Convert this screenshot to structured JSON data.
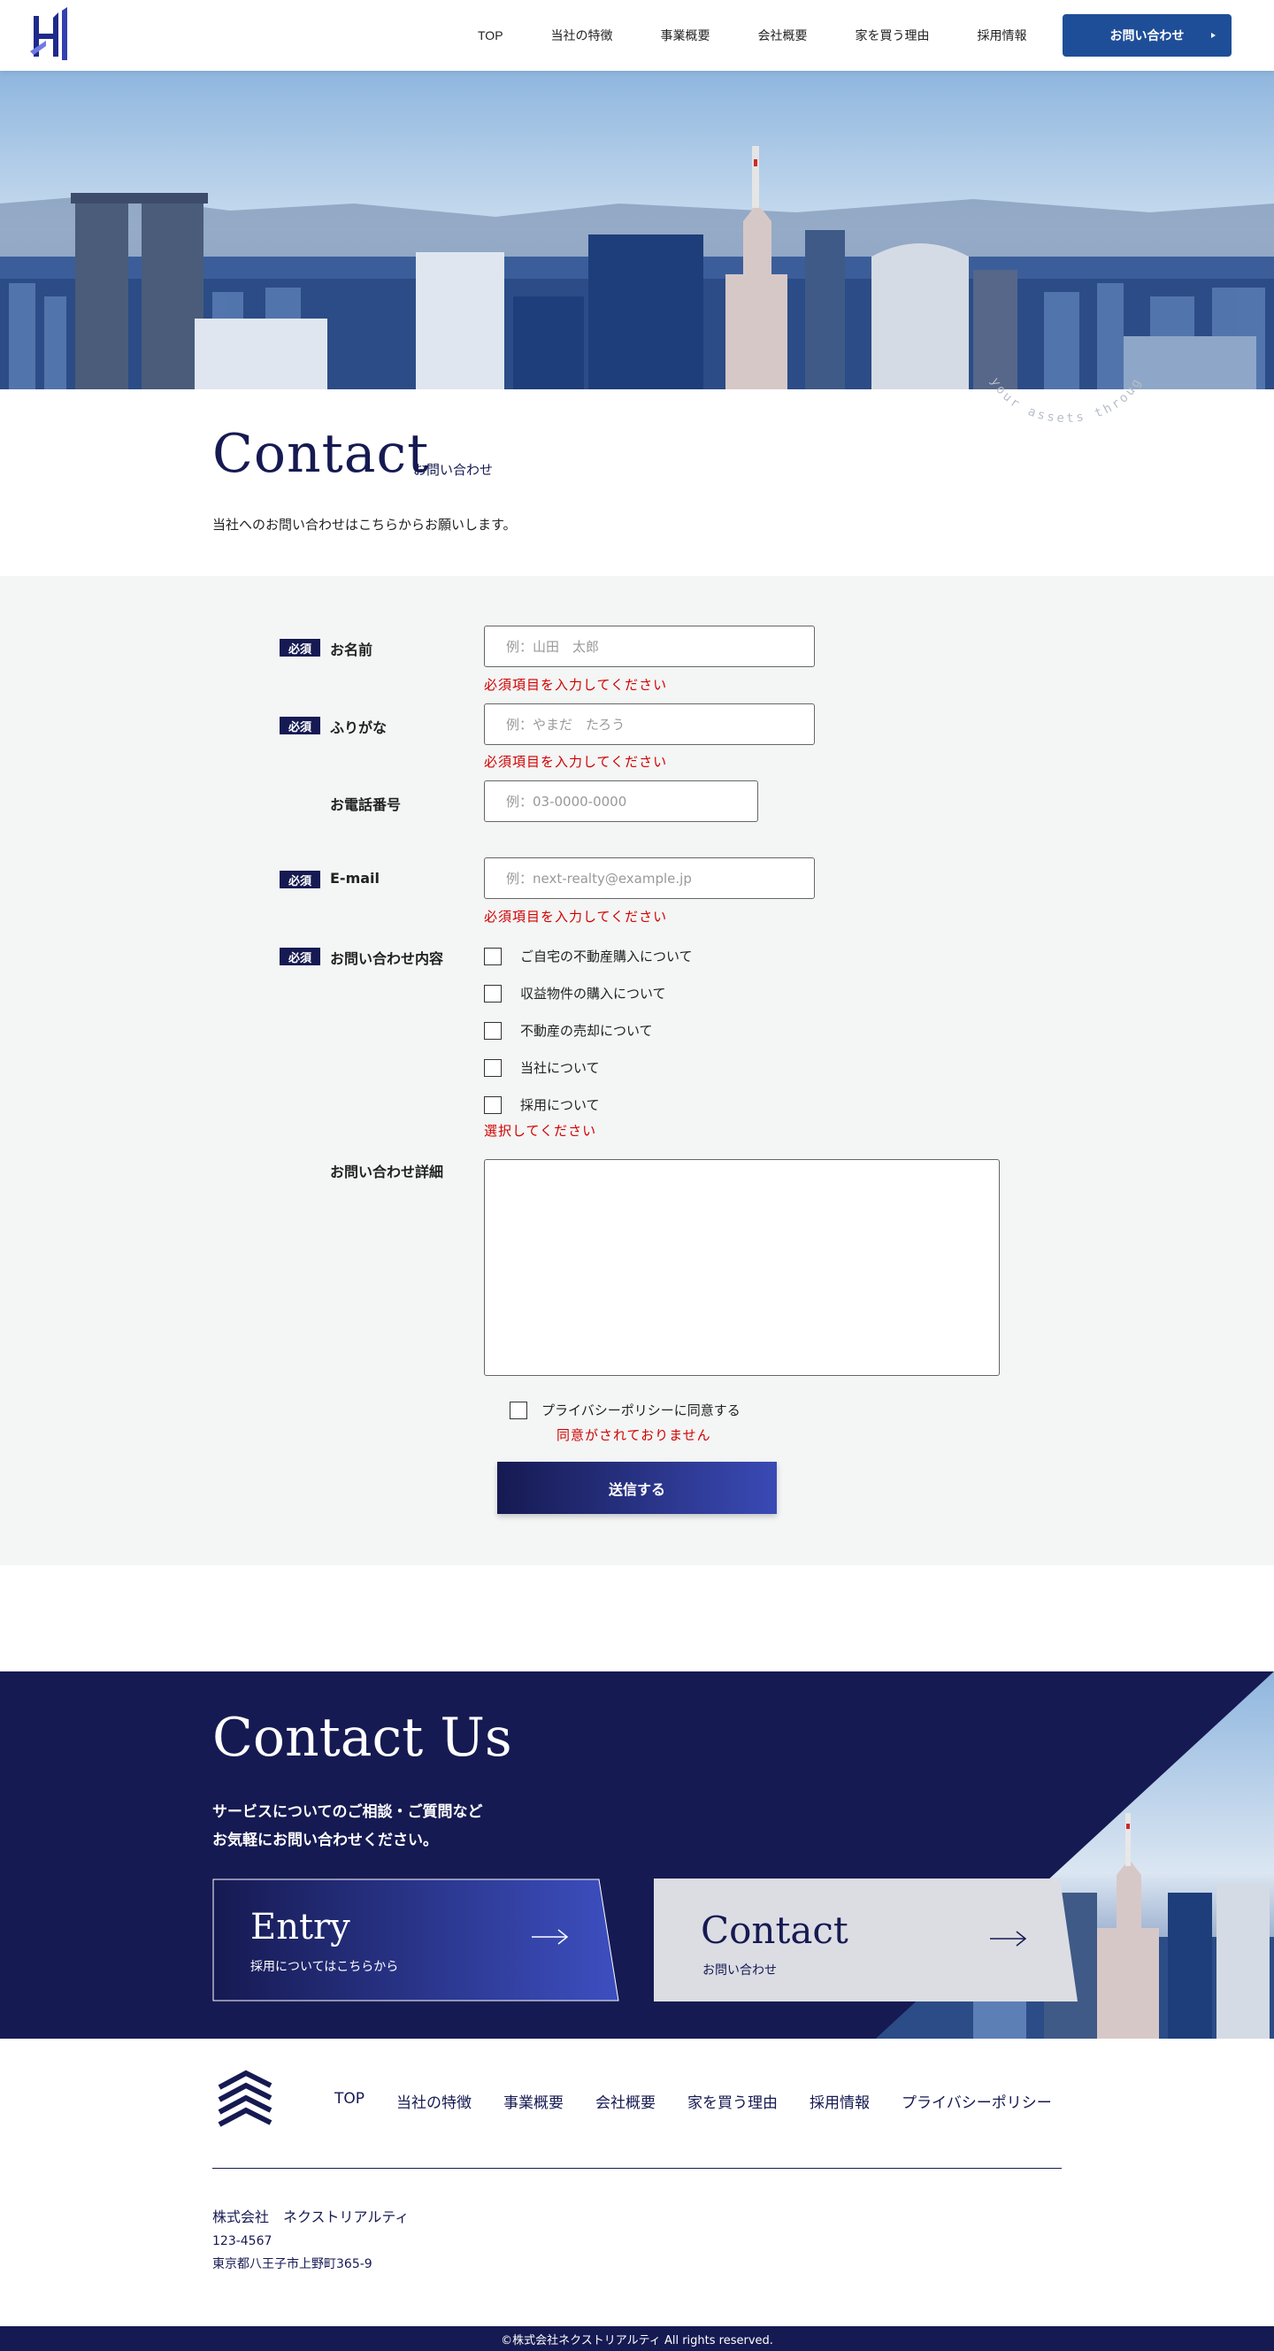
{
  "header": {
    "nav": [
      "TOP",
      "当社の特徴",
      "事業概要",
      "会社概要",
      "家を買う理由",
      "採用情報"
    ],
    "cta_label": "お問い合わせ"
  },
  "hero": {
    "circle_text": "your assets through"
  },
  "contact": {
    "title": "Contact",
    "subtitle": "お問い合わせ",
    "lead": "当社へのお問い合わせはこちらからお願いします。"
  },
  "form": {
    "required_label": "必須",
    "name": {
      "label": "お名前",
      "placeholder": "例：山田　太郎",
      "error": "必須項目を入力してください"
    },
    "kana": {
      "label": "ふりがな",
      "placeholder": "例：やまだ　たろう",
      "error": "必須項目を入力してください"
    },
    "phone": {
      "label": "お電話番号",
      "placeholder": "例：03-0000-0000"
    },
    "email": {
      "label": "E-mail",
      "placeholder": "例：next-realty@example.jp",
      "error": "必須項目を入力してください"
    },
    "inquiry": {
      "label": "お問い合わせ内容",
      "options": [
        "ご自宅の不動産購入について",
        "収益物件の購入について",
        "不動産の売却について",
        "当社について",
        "採用について"
      ],
      "error": "選択してください"
    },
    "detail": {
      "label": "お問い合わせ詳細"
    },
    "privacy": {
      "label": "プライバシーポリシーに同意する",
      "error": "同意がされておりません"
    },
    "submit_label": "送信する"
  },
  "contact_us": {
    "title": "Contact Us",
    "lead_1": "サービスについてのご相談・ご質問など",
    "lead_2": "お気軽にお問い合わせください。",
    "entry_title": "Entry",
    "entry_sub": "採用についてはこちらから",
    "contact_title": "Contact",
    "contact_sub": "お問い合わせ"
  },
  "footer": {
    "nav": [
      "TOP",
      "当社の特徴",
      "事業概要",
      "会社概要",
      "家を買う理由",
      "採用情報",
      "プライバシーポリシー"
    ],
    "company": "株式会社　ネクストリアルティ",
    "zip": "123-4567",
    "address": "東京都八王子市上野町365-9",
    "copyright": "©株式会社ネクストリアルティ All rights reserved."
  },
  "colors": {
    "navy": "#161a52",
    "header_button": "#1f4e98",
    "error": "#d10000",
    "form_bg": "#f4f5f5"
  }
}
